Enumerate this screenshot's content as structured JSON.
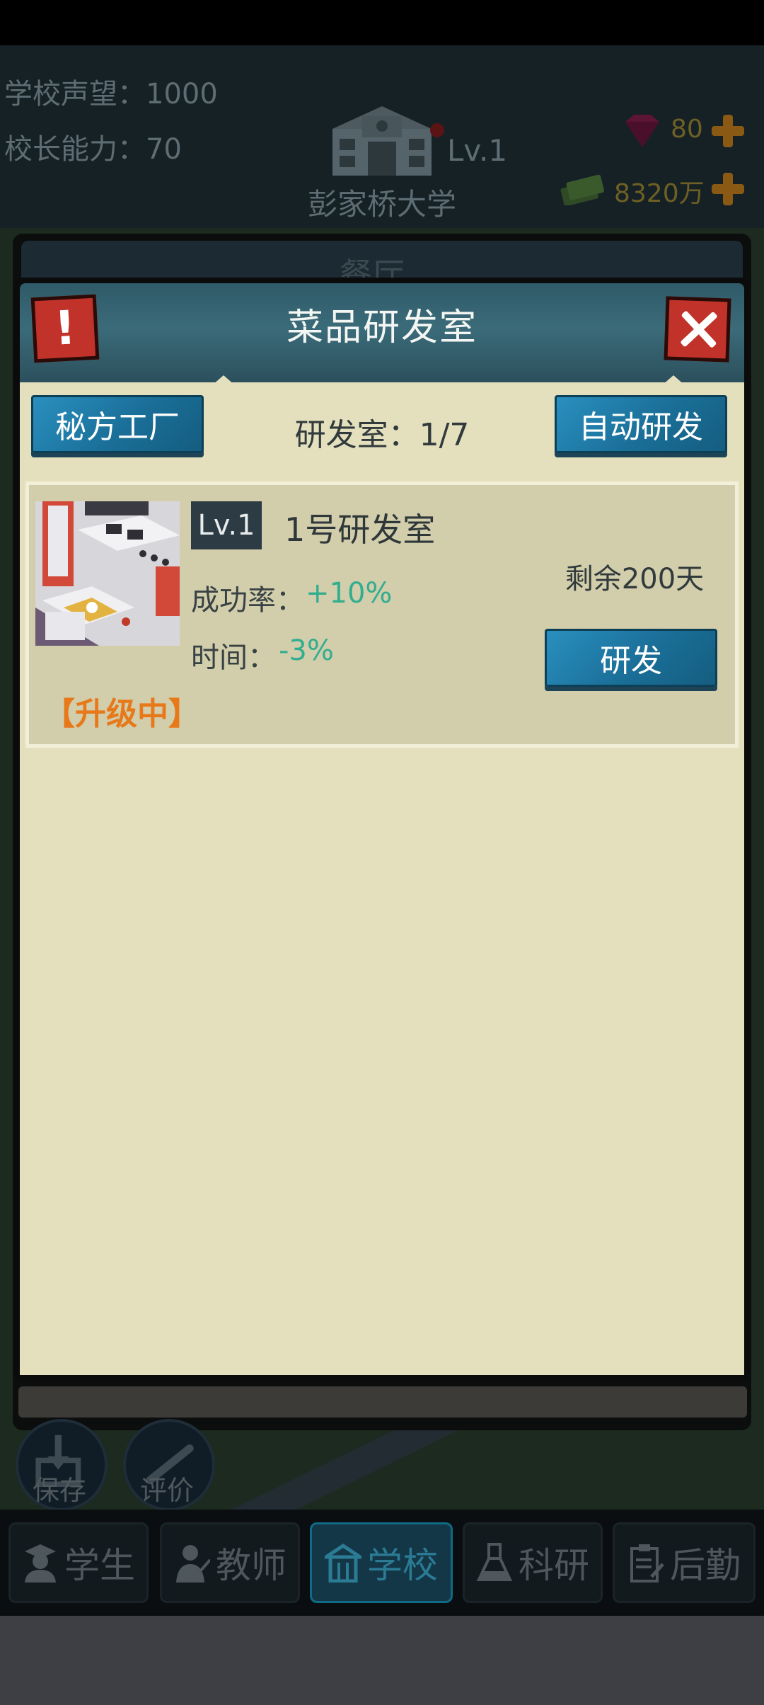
{
  "hud": {
    "reputation": "学校声望：1000",
    "ability": "校长能力：70",
    "school_level": "Lv.1",
    "school_name": "彭家桥大学",
    "gems": "80",
    "cash": "8320万"
  },
  "background_panel": {
    "title": "餐厅"
  },
  "modal": {
    "title": "菜品研发室",
    "secret_factory_label": "秘方工厂",
    "lab_count": "研发室：1/7",
    "auto_research_label": "自动研发"
  },
  "labs": [
    {
      "level": "Lv.1",
      "name": "1号研发室",
      "success_label": "成功率：",
      "success_value": "+10%",
      "time_label": "时间：",
      "time_value": "-3%",
      "remaining": "剩余200天",
      "research_label": "研发",
      "status": "【升级中】"
    }
  ],
  "actions": {
    "save": "保存",
    "review": "评价"
  },
  "nav": {
    "tabs": [
      {
        "label": "学生",
        "icon": "student-icon"
      },
      {
        "label": "教师",
        "icon": "teacher-icon"
      },
      {
        "label": "学校",
        "icon": "school-icon",
        "active": true
      },
      {
        "label": "科研",
        "icon": "research-flask-icon"
      },
      {
        "label": "后勤",
        "icon": "logistics-clipboard-icon"
      }
    ]
  },
  "colors": {
    "modal_body": "#e4e0bd",
    "header_teal": "#3b6b79",
    "button_blue": "#1a6f98",
    "positive_green": "#31ae8f",
    "upgrading_orange": "#e7791b",
    "close_red": "#c1332a"
  }
}
